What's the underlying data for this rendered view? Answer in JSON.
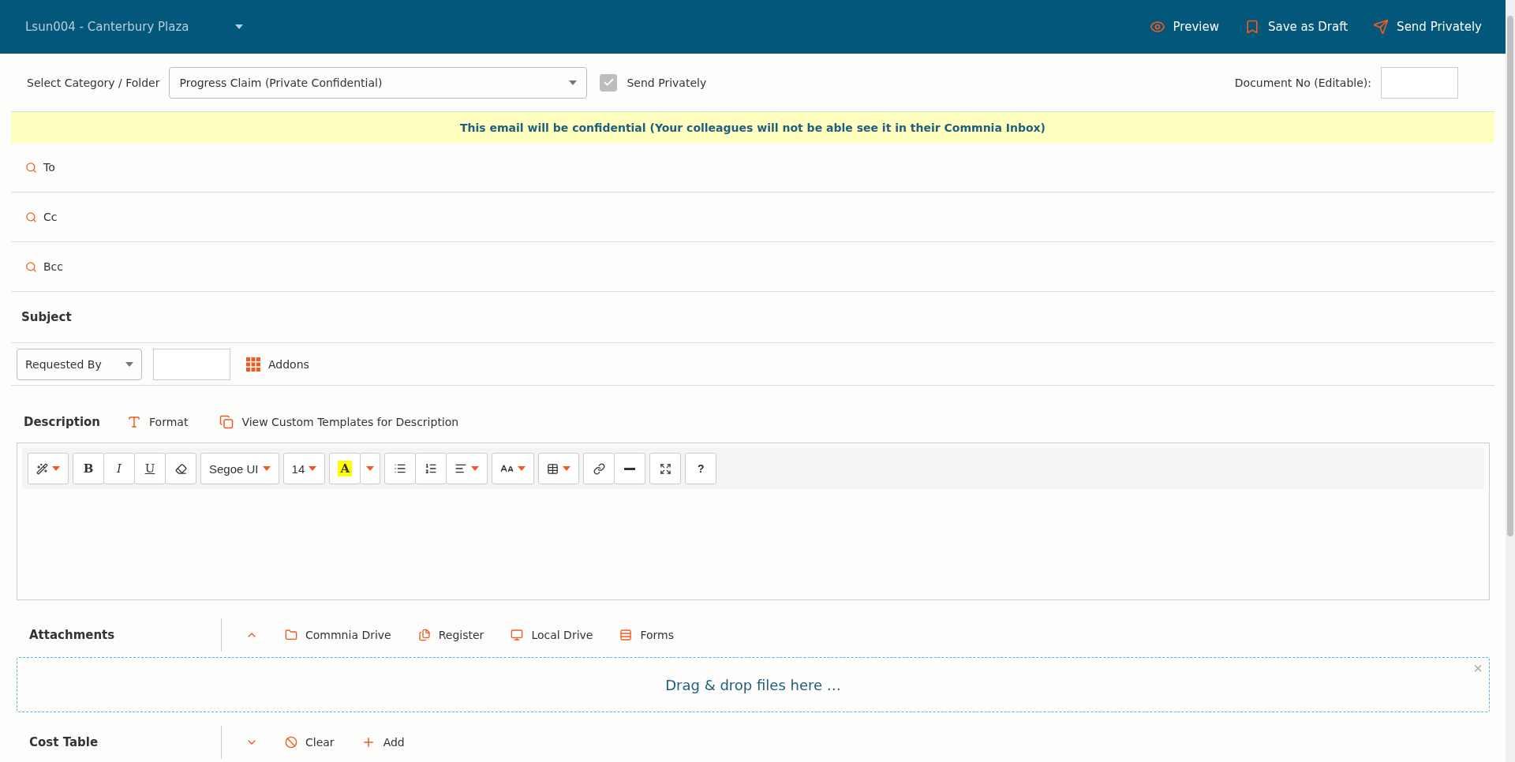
{
  "header": {
    "project": "Lsun004 - Canterbury Plaza",
    "actions": [
      {
        "kind": "preview",
        "label": "Preview"
      },
      {
        "kind": "draft",
        "label": "Save as Draft"
      },
      {
        "kind": "send",
        "label": "Send Privately"
      }
    ]
  },
  "category": {
    "label": "Select Category / Folder",
    "value": "Progress Claim (Private Confidential)",
    "send_privately": {
      "label": "Send Privately",
      "checked": true
    },
    "document_no_label": "Document No (Editable):"
  },
  "notice": "This email will be confidential (Your colleagues will not be able see it in their Commnia Inbox)",
  "recipients": [
    {
      "label": "To"
    },
    {
      "label": "Cc"
    },
    {
      "label": "Bcc"
    }
  ],
  "subject": {
    "label": "Subject"
  },
  "requested_by": {
    "value": "Requested By",
    "addons": "Addons"
  },
  "description": {
    "label": "Description",
    "format": "Format",
    "templates": "View Custom Templates for Description",
    "toolbar": {
      "bold": "B",
      "italic": "I",
      "underline": "U",
      "font": "Segoe UI",
      "size": "14",
      "highlight": "A",
      "help": "?"
    }
  },
  "attachments": {
    "label": "Attachments",
    "expanded": true,
    "sources": [
      {
        "kind": "folder",
        "label": "Commnia Drive"
      },
      {
        "kind": "register",
        "label": "Register"
      },
      {
        "kind": "local",
        "label": "Local Drive"
      },
      {
        "kind": "forms",
        "label": "Forms"
      }
    ],
    "dropzone": "Drag & drop files here …",
    "close": "×"
  },
  "cost_table": {
    "label": "Cost Table",
    "expanded": false,
    "actions": [
      {
        "kind": "clear",
        "label": "Clear"
      },
      {
        "kind": "add",
        "label": "Add"
      }
    ]
  }
}
